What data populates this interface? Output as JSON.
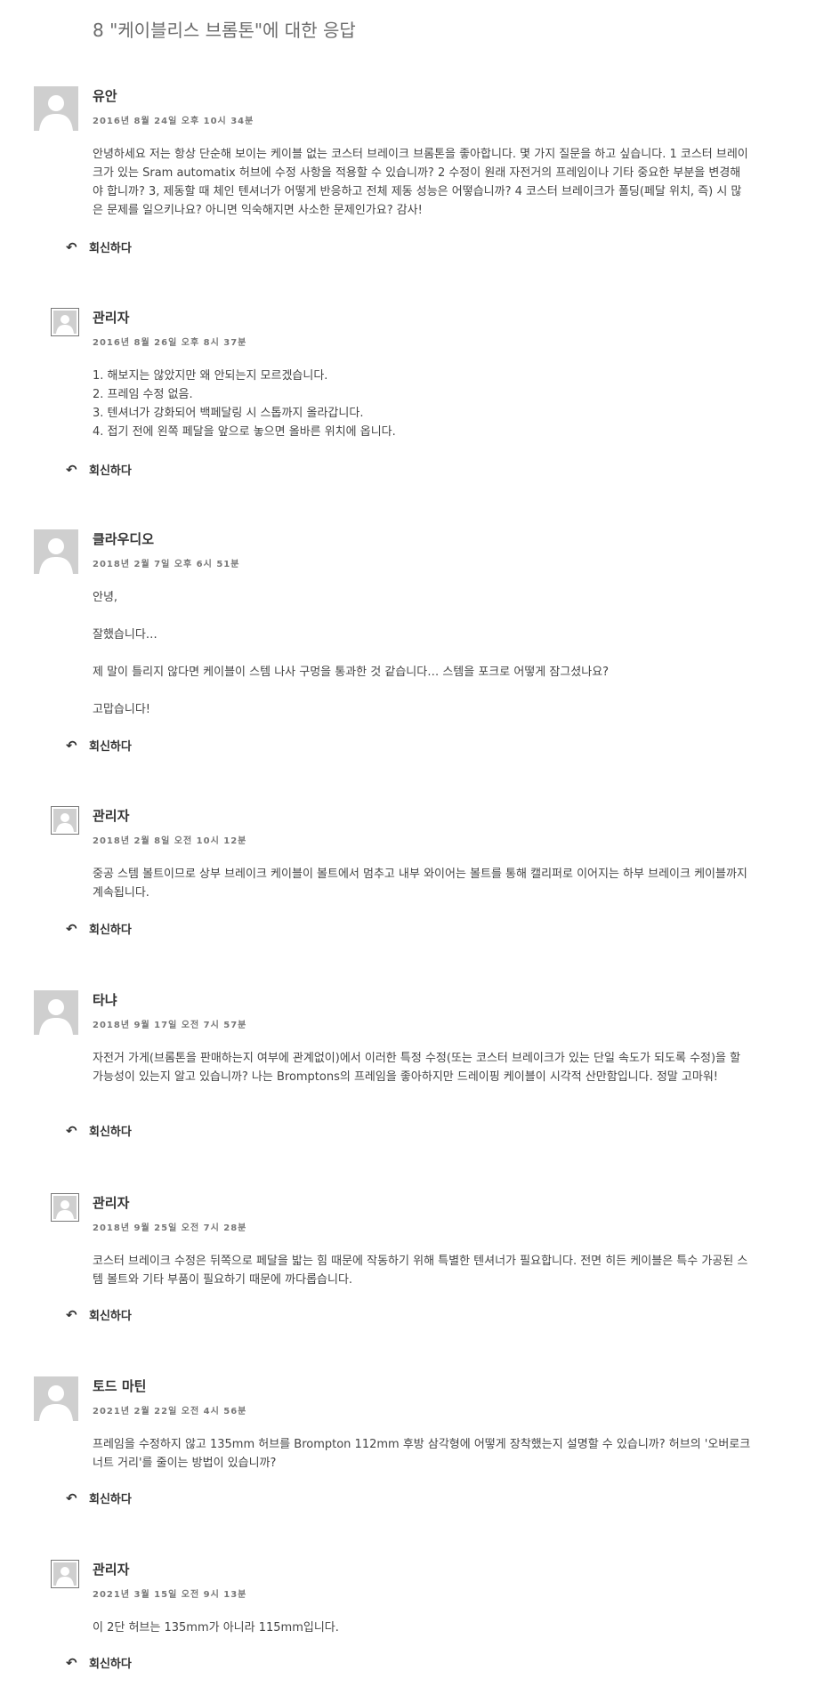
{
  "heading": "8 \"케이블리스 브롬톤\"에 대한 응답",
  "reply_label": "회신하다",
  "comments": [
    {
      "author": "유안",
      "date": "2016년 8월 24일 오후 10시 34분",
      "paragraphs": [
        "안녕하세요 저는 항상 단순해 보이는 케이블 없는 코스터 브레이크 브롬톤을 좋아합니다. 몇 가지 질문을 하고 싶습니다. 1 코스터 브레이크가 있는 Sram automatix 허브에 수정 사항을 적용할 수 있습니까? 2 수정이 원래 자전거의 프레임이나 기타 중요한 부분을 변경해야 합니까? 3, 제동할 때 체인 텐셔너가 어떻게 반응하고 전체 제동 성능은 어떻습니까? 4 코스터 브레이크가 폴딩(페달 위치, 즉) 시 많은 문제를 일으키나요? 아니면 익숙해지면 사소한 문제인가요? 감사!"
      ]
    },
    {
      "author": "관리자",
      "date": "2016년 8월 26일 오후 8시 37분",
      "lines": [
        "1. 해보지는 않았지만 왜 안되는지 모르겠습니다.",
        "2. 프레임 수정 없음.",
        "3. 텐셔너가 강화되어 백페달링 시 스톱까지 올라갑니다.",
        "4. 접기 전에 왼쪽 페달을 앞으로 놓으면 올바른 위치에 옵니다."
      ]
    },
    {
      "author": "클라우디오",
      "date": "2018년 2월 7일 오후 6시 51분",
      "paragraphs": [
        "안녕,",
        "잘했습니다…",
        "제 말이 틀리지 않다면 케이블이 스템 나사 구멍을 통과한 것 같습니다… 스템을 포크로 어떻게 잠그셨나요?",
        "고맙습니다!"
      ]
    },
    {
      "author": "관리자",
      "date": "2018년 2월 8일 오전 10시 12분",
      "paragraphs": [
        "중공 스템 볼트이므로 상부 브레이크 케이블이 볼트에서 멈추고 내부 와이어는 볼트를 통해 캘리퍼로 이어지는 하부 브레이크 케이블까지 계속됩니다."
      ]
    },
    {
      "author": "타냐",
      "date": "2018년 9월 17일 오전 7시 57분",
      "paragraphs": [
        "자전거 가게(브롬톤을 판매하는지 여부에 관계없이)에서 이러한 특정 수정(또는 코스터 브레이크가 있는 단일 속도가 되도록 수정)을 할 가능성이 있는지 알고 있습니까? 나는 Bromptons의 프레임을 좋아하지만 드레이핑 케이블이 시각적 산만함입니다. 정말 고마워!"
      ]
    },
    {
      "author": "관리자",
      "date": "2018년 9월 25일 오전 7시 28분",
      "paragraphs": [
        "코스터 브레이크 수정은 뒤쪽으로 페달을 밟는 힘 때문에 작동하기 위해 특별한 텐셔너가 필요합니다. 전면 히든 케이블은 특수 가공된 스템 볼트와 기타 부품이 필요하기 때문에 까다롭습니다."
      ]
    },
    {
      "author": "토드 마틴",
      "date": "2021년 2월 22일 오전 4시 56분",
      "paragraphs": [
        "프레임을 수정하지 않고 135mm 허브를 Brompton 112mm 후방 삼각형에 어떻게 장착했는지 설명할 수 있습니까? 허브의 '오버로크너트 거리'를 줄이는 방법이 있습니까?"
      ]
    },
    {
      "author": "관리자",
      "date": "2021년 3월 15일 오전 9시 13분",
      "paragraphs": [
        "이 2단 허브는 135mm가 아니라 115mm입니다."
      ]
    }
  ]
}
